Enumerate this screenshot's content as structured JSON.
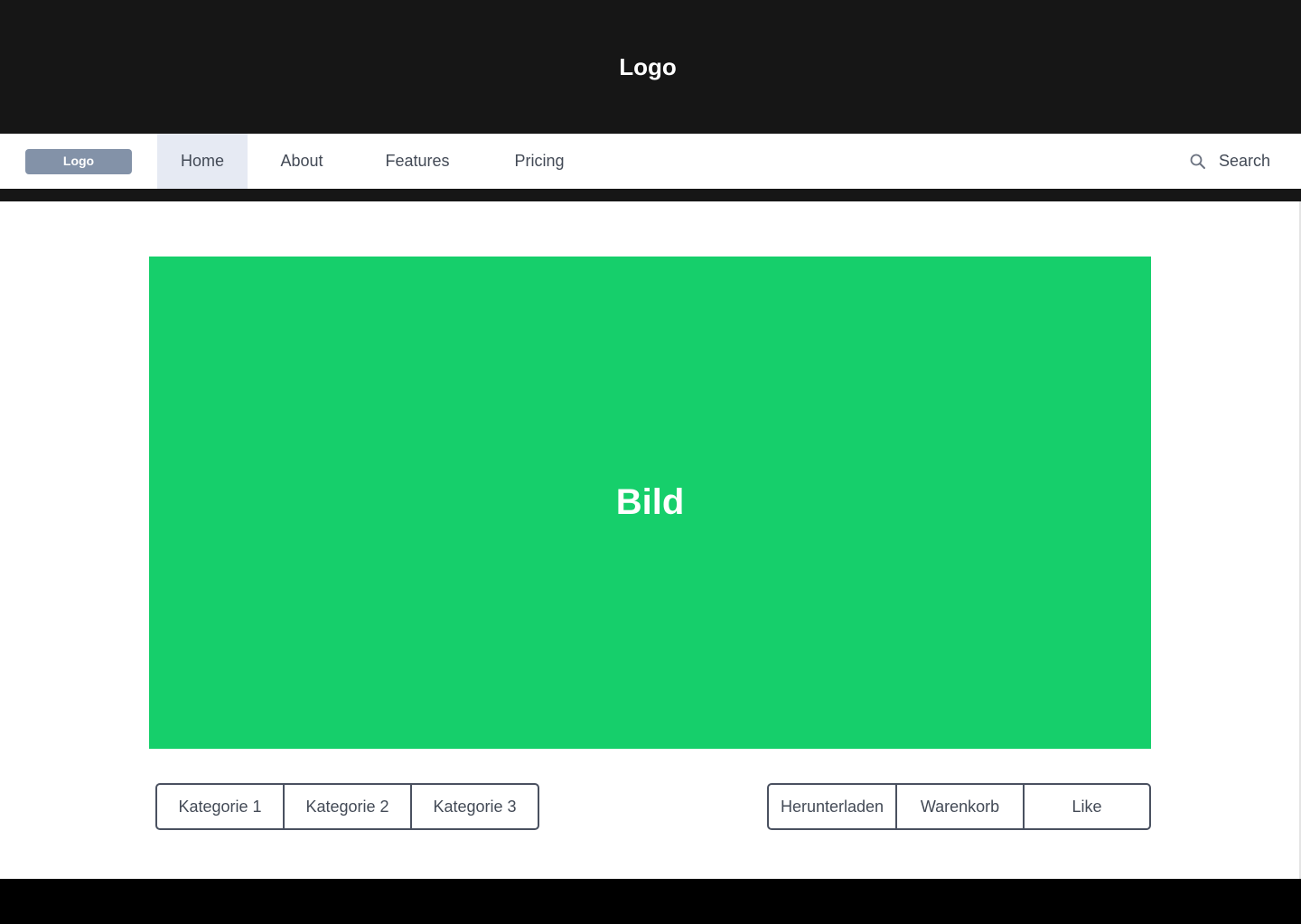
{
  "header": {
    "logo_text": "Logo"
  },
  "nav": {
    "logo_button_label": "Logo",
    "items": [
      {
        "label": "Home",
        "active": true
      },
      {
        "label": "About",
        "active": false
      },
      {
        "label": "Features",
        "active": false
      },
      {
        "label": "Pricing",
        "active": false
      }
    ],
    "search_label": "Search",
    "search_icon": "search-icon"
  },
  "hero": {
    "label": "Bild",
    "color": "#16cf6b"
  },
  "category_buttons": [
    "Kategorie 1",
    "Kategorie 2",
    "Kategorie 3"
  ],
  "action_buttons": [
    "Herunterladen",
    "Warenkorb",
    "Like"
  ],
  "colors": {
    "dark_header": "#161616",
    "nav_active_bg": "#e6eaf3",
    "logo_button_bg": "#8392a8",
    "footer": "#000000"
  }
}
